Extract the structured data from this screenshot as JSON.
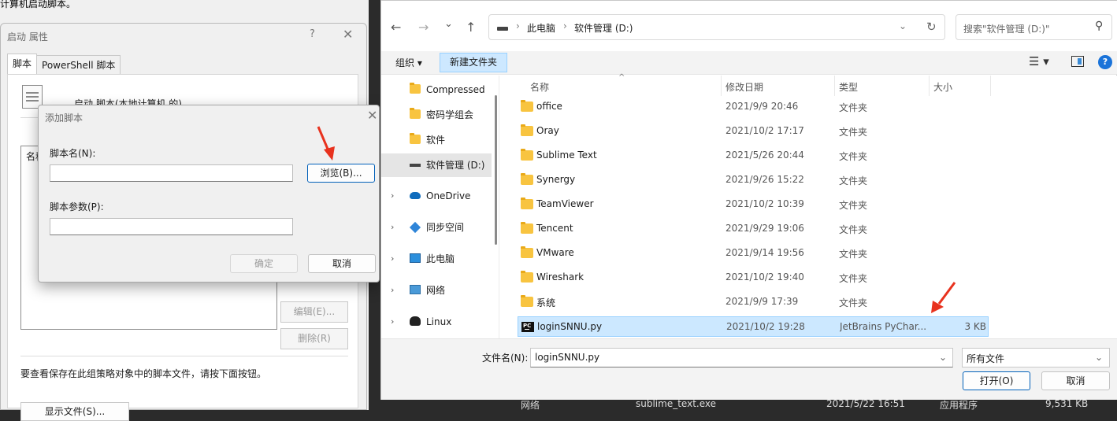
{
  "background": {
    "policy_title": "计算机启动脚本。"
  },
  "props_dialog": {
    "title": "启动 属性",
    "help": "?",
    "close": "✕",
    "tabs": [
      "脚本",
      "PowerShell 脚本"
    ],
    "header": "启动 脚本(本地计算机 的)",
    "list_col": "名称",
    "edit_btn": "编辑(E)...",
    "delete_btn": "删除(R)",
    "hint": "要查看保存在此组策略对象中的脚本文件，请按下面按钮。",
    "show_files_btn": "显示文件(S)..."
  },
  "add_script": {
    "title": "添加脚本",
    "close": "✕",
    "script_name_label": "脚本名(N):",
    "script_name_value": "",
    "browse_btn": "浏览(B)...",
    "script_params_label": "脚本参数(P):",
    "script_params_value": "",
    "ok_btn": "确定",
    "cancel_btn": "取消"
  },
  "file_dialog": {
    "nav": {
      "back": "←",
      "forward": "→",
      "recent": "⌄",
      "up": "↑"
    },
    "address": {
      "crumbs": [
        "此电脑",
        "软件管理 (D:)"
      ],
      "sep": "›",
      "dropdown": "⌄",
      "refresh": "↻"
    },
    "search_placeholder": "搜索\"软件管理 (D:)\"",
    "toolbar": {
      "organize": "组织 ▾",
      "new_folder": "新建文件夹",
      "view": "☰ ▾",
      "help": "?"
    },
    "tree": [
      {
        "label": "Compressed",
        "icon": "folder-icon",
        "chevron": "",
        "selected": false
      },
      {
        "label": "密码学组会",
        "icon": "folder-icon",
        "chevron": "",
        "selected": false
      },
      {
        "label": "软件",
        "icon": "folder-icon",
        "chevron": "",
        "selected": false
      },
      {
        "label": "软件管理 (D:)",
        "icon": "drive-icon",
        "chevron": "",
        "selected": true
      },
      {
        "label": "OneDrive",
        "icon": "cloud-icon",
        "chevron": "›",
        "selected": false
      },
      {
        "label": "同步空间",
        "icon": "sync-icon",
        "chevron": "›",
        "selected": false
      },
      {
        "label": "此电脑",
        "icon": "pc-icon",
        "chevron": "›",
        "selected": false
      },
      {
        "label": "网络",
        "icon": "network-icon",
        "chevron": "›",
        "selected": false
      },
      {
        "label": "Linux",
        "icon": "linux-icon",
        "chevron": "›",
        "selected": false
      }
    ],
    "columns": [
      "名称",
      "修改日期",
      "类型",
      "大小"
    ],
    "sort_indicator": "^",
    "files": [
      {
        "name": "office",
        "date": "2021/9/9 20:46",
        "type": "文件夹",
        "size": "",
        "icon": "folder-icon",
        "selected": false
      },
      {
        "name": "Oray",
        "date": "2021/10/2 17:17",
        "type": "文件夹",
        "size": "",
        "icon": "folder-icon",
        "selected": false
      },
      {
        "name": "Sublime Text",
        "date": "2021/5/26 20:44",
        "type": "文件夹",
        "size": "",
        "icon": "folder-icon",
        "selected": false
      },
      {
        "name": "Synergy",
        "date": "2021/9/26 15:22",
        "type": "文件夹",
        "size": "",
        "icon": "folder-icon",
        "selected": false
      },
      {
        "name": "TeamViewer",
        "date": "2021/10/2 10:39",
        "type": "文件夹",
        "size": "",
        "icon": "folder-icon",
        "selected": false
      },
      {
        "name": "Tencent",
        "date": "2021/9/29 19:06",
        "type": "文件夹",
        "size": "",
        "icon": "folder-icon",
        "selected": false
      },
      {
        "name": "VMware",
        "date": "2021/9/14 19:56",
        "type": "文件夹",
        "size": "",
        "icon": "folder-icon",
        "selected": false
      },
      {
        "name": "Wireshark",
        "date": "2021/10/2 19:40",
        "type": "文件夹",
        "size": "",
        "icon": "folder-icon",
        "selected": false
      },
      {
        "name": "系统",
        "date": "2021/9/9 17:39",
        "type": "文件夹",
        "size": "",
        "icon": "folder-icon",
        "selected": false
      },
      {
        "name": "loginSNNU.py",
        "date": "2021/10/2 19:28",
        "type": "JetBrains PyChar...",
        "size": "3 KB",
        "icon": "pycharm-file-icon",
        "selected": true
      }
    ],
    "filename_label": "文件名(N):",
    "filename_value": "loginSNNU.py",
    "filter_value": "所有文件",
    "dropdown": "⌄",
    "open_btn": "打开(O)",
    "cancel_btn": "取消"
  },
  "under_strip": {
    "network_label": "网络",
    "file_name": "sublime_text.exe",
    "file_date": "2021/5/22 16:51",
    "file_type": "应用程序",
    "file_size": "9,531 KB"
  },
  "colors": {
    "accent": "#005fb8",
    "selection": "#cce8ff",
    "annotation_arrow": "#e8321e",
    "folder": "#f8c440"
  }
}
